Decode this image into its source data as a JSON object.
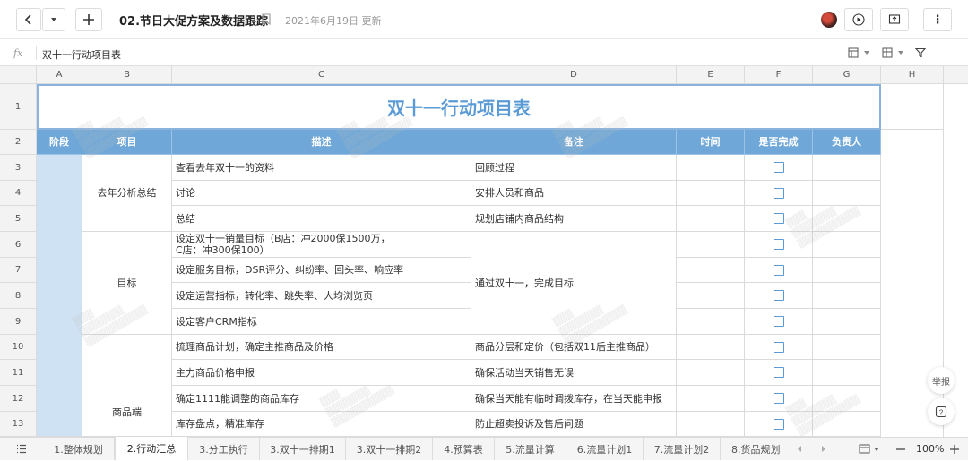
{
  "titlebar": {
    "back_label": "‹",
    "menu_label": "▾",
    "add_label": "+",
    "doc_title": "02.节日大促方案及数据跟踪",
    "updated": "2021年6月19日 更新",
    "more_label": "⋮"
  },
  "formula_bar": {
    "fx": "fx",
    "value": "双十一行动项目表"
  },
  "columns": [
    "A",
    "B",
    "C",
    "D",
    "E",
    "F",
    "G",
    "H"
  ],
  "rows": [
    "1",
    "2",
    "3",
    "4",
    "5",
    "6",
    "7",
    "8",
    "9",
    "10",
    "11",
    "12",
    "13"
  ],
  "sheet": {
    "title": "双十一行动项目表",
    "headers": [
      "阶段",
      "项目",
      "描述",
      "备注",
      "时间",
      "是否完成",
      "负责人"
    ],
    "groups": [
      "去年分析总结",
      "目标",
      "商品端"
    ],
    "desc": [
      "查看去年双十一的资料",
      "讨论",
      "总结",
      "设定双十一销量目标（B店：冲2000保1500万，\nC店：冲300保100）",
      "设定服务目标，DSR评分、纠纷率、回头率、响应率",
      "设定运营指标，转化率、跳失率、人均浏览页",
      "设定客户CRM指标",
      "梳理商品计划，确定主推商品及价格",
      "主力商品价格申报",
      "确定1111能调整的商品库存",
      "库存盘点，精准库存"
    ],
    "notes": {
      "r3": "回顾过程",
      "r4": "安排人员和商品",
      "r5": "规划店铺内商品结构",
      "r6_9": "通过双十一，完成目标",
      "r10": "商品分层和定价（包括双11后主推商品）",
      "r11": "确保活动当天销售无误",
      "r12": "确保当天能有临时调拨库存，在当天能申报",
      "r13": "防止超卖投诉及售后问题"
    }
  },
  "floating": {
    "report_label": "举报",
    "help_label": "?"
  },
  "tabs": [
    "1.整体规划",
    "2.行动汇总",
    "3.分工执行",
    "3.双十一排期1",
    "3.双十一排期2",
    "4.预算表",
    "5.流量计算",
    "6.流量计划1",
    "7.流量计划2",
    "8.货品规划"
  ],
  "zoom": "100%",
  "colors": {
    "header_blue": "#6fa8d8",
    "phase_blue": "#cfe2f3",
    "title_blue": "#5b9bd5"
  }
}
